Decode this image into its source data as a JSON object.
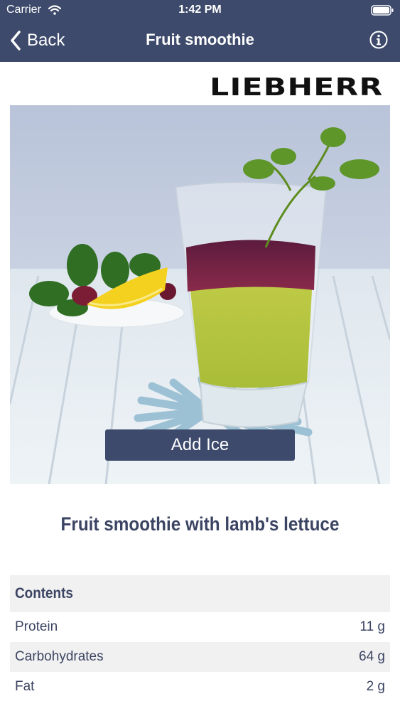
{
  "status_bar": {
    "carrier": "Carrier",
    "time": "1:42 PM"
  },
  "nav": {
    "back_label": "Back",
    "title": "Fruit smoothie"
  },
  "brand": {
    "logo": "LIEBHERR"
  },
  "photo": {
    "button_label": "Add Ice"
  },
  "recipe": {
    "title": "Fruit smoothie with lamb's lettuce"
  },
  "contents": {
    "header": "Contents",
    "rows": [
      {
        "label": "Protein",
        "value": "11 g"
      },
      {
        "label": "Carbohydrates",
        "value": "64 g"
      },
      {
        "label": "Fat",
        "value": "2 g"
      }
    ]
  },
  "colors": {
    "nav_bg": "#3d4a6b",
    "text": "#3b4462",
    "row_alt": "#f1f1f1"
  }
}
